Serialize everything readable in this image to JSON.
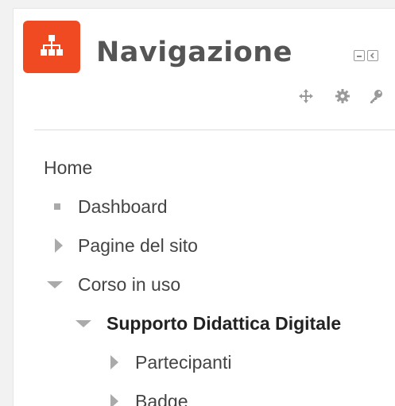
{
  "block": {
    "title": "Navigazione",
    "logo_icon": "sitemap-icon",
    "accent_color": "#f04a22"
  },
  "nav": {
    "home": "Home",
    "items": [
      {
        "label": "Dashboard",
        "marker": "square-bullet-icon"
      },
      {
        "label": "Pagine del sito",
        "marker": "triangle-right-icon"
      },
      {
        "label": "Corso in uso",
        "marker": "triangle-down-icon"
      },
      {
        "label": "Supporto Didattica Digitale",
        "marker": "triangle-down-icon"
      },
      {
        "label": "Partecipanti",
        "marker": "triangle-right-icon"
      },
      {
        "label": "Badge",
        "marker": "triangle-right-icon"
      }
    ]
  }
}
